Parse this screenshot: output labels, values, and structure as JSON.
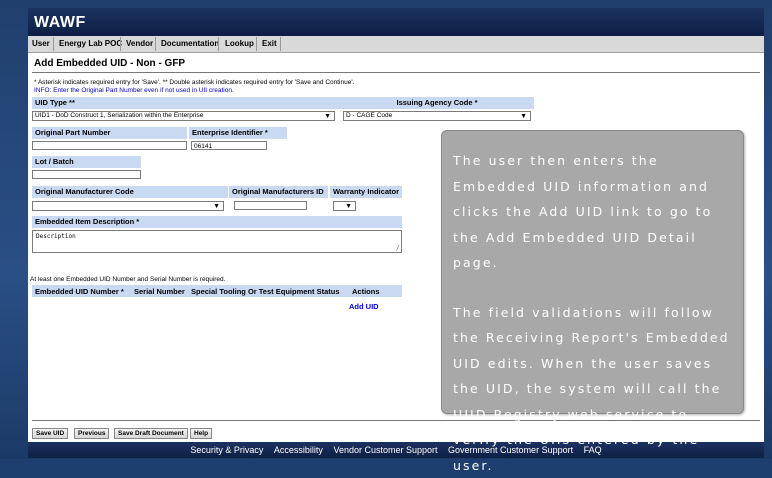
{
  "app": {
    "brand": "WAWF"
  },
  "menu": [
    "User",
    "Energy Lab POC",
    "Vendor",
    "Documentation",
    "Lookup",
    "Exit"
  ],
  "page_title": "Add Embedded UID - Non - GFP",
  "notes": {
    "required": "* Asterisk indicates required entry for 'Save'.   ** Double asterisk indicates required entry for 'Save and Continue'.",
    "info": "INFO: Enter the Original Part Number even if not used in UII creation."
  },
  "form": {
    "uid_type_label": "UID Type **",
    "uid_type_value": "UID1 - DoD Construct 1, Serialization within the Enterprise",
    "issuing_agency_label": "Issuing Agency Code *",
    "issuing_agency_value": "D - CAGE Code",
    "orig_part_label": "Original Part Number",
    "orig_part_value": "",
    "enterprise_id_label": "Enterprise Identifier *",
    "enterprise_id_value": "06141",
    "lot_label": "Lot / Batch",
    "lot_value": "",
    "orig_mfr_code_label": "Original Manufacturer Code",
    "orig_mfr_code_value": "",
    "orig_mfr_id_label": "Original Manufacturers ID",
    "orig_mfr_id_value": "",
    "warranty_label": "Warranty Indicator",
    "warranty_value": "",
    "desc_label": "Embedded Item Description *",
    "desc_value": "Description"
  },
  "table": {
    "note": "At least one Embedded UID Number and Serial Number is required.",
    "headers": [
      "Embedded UID Number *",
      "Serial Number",
      "Special Tooling Or Test Equipment Status",
      "Actions"
    ],
    "add_link": "Add UID"
  },
  "buttons": [
    "Save UID",
    "Previous",
    "Save Draft Document",
    "Help"
  ],
  "footer": [
    "Security & Privacy",
    "Accessibility",
    "Vendor Customer Support",
    "Government Customer Support",
    "FAQ"
  ],
  "callout": {
    "p1": "The user then enters the Embedded UID information and clicks the Add UID link to go to the Add Embedded UID Detail page.",
    "p2": "The field validations will follow the Receiving Report's Embedded UID edits. When the user saves the UID, the system will call the IUID Registry web service to verify the UIIs entered by the user."
  },
  "colors": {
    "header": "#0d1f45",
    "label_bg": "#c9d9f2",
    "link": "#0000ee",
    "callout_bg": "#a8a8a8"
  }
}
